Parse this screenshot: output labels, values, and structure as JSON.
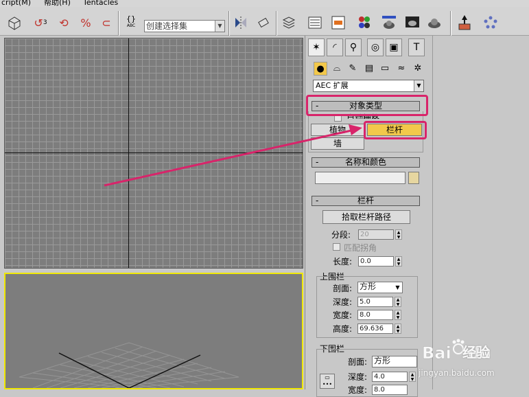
{
  "menu": {
    "items": [
      "cript(M)",
      "帮助(H)",
      "Tentacles"
    ]
  },
  "toolbar": {
    "selection_set_placeholder": "创建选择集",
    "abc_label": "ABC",
    "braces": "{}"
  },
  "panel": {
    "category_dropdown": "AEC 扩展",
    "object_type": {
      "title": "对象类型",
      "auto_grid": "自动栅格",
      "buttons": [
        "植物",
        "栏杆",
        "墙"
      ]
    },
    "name_color": {
      "title": "名称和颜色",
      "name_value": ""
    },
    "railing": {
      "title": "栏杆",
      "pick_path_button": "拾取栏杆路径",
      "segments_label": "分段:",
      "segments_value": "20",
      "match_corners_label": "匹配拐角",
      "length_label": "长度:",
      "length_value": "0.0",
      "top_rail": {
        "title": "上围栏",
        "profile_label": "剖面:",
        "profile_value": "方形",
        "depth_label": "深度:",
        "depth_value": "5.0",
        "width_label": "宽度:",
        "width_value": "8.0",
        "height_label": "高度:",
        "height_value": "69.636"
      },
      "bottom_rail": {
        "title": "下围栏",
        "profile_label": "剖面:",
        "profile_value": "方形",
        "depth_label": "深度:",
        "depth_value": "4.0",
        "width_label": "宽度:",
        "width_value": "8.0"
      }
    },
    "collapse_symbol": "-"
  },
  "colors": {
    "highlight": "#d8246a",
    "active_button": "#f2c84b",
    "viewport_active_border": "#f0e800",
    "viewport_bg": "#7d7d7d"
  },
  "watermark": {
    "brand": "Baidu经验",
    "url": "jingyan.baidu.com"
  }
}
